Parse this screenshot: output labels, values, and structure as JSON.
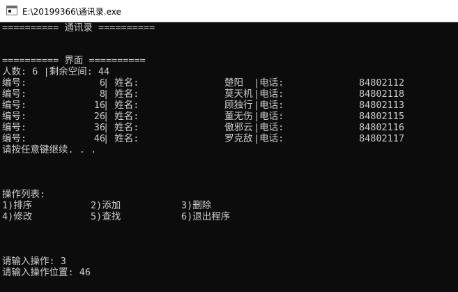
{
  "window": {
    "title": "E:\\20199366\\通讯录.exe"
  },
  "console": {
    "header": "========== 通讯录 ==========",
    "section": "========== 界面 ==========",
    "summary": "人数: 6 |剩余空间: 44",
    "records": [
      {
        "id_label": "编号:",
        "id": "6",
        "name_label": "| 姓名:",
        "name": "楚阳",
        "phone_label": "|电话:",
        "phone": "84802112"
      },
      {
        "id_label": "编号:",
        "id": "8",
        "name_label": "| 姓名:",
        "name": "莫天机",
        "phone_label": "|电话:",
        "phone": "84802118"
      },
      {
        "id_label": "编号:",
        "id": "16",
        "name_label": "| 姓名:",
        "name": "顾独行",
        "phone_label": "|电话:",
        "phone": "84802113"
      },
      {
        "id_label": "编号:",
        "id": "26",
        "name_label": "| 姓名:",
        "name": "董无伤",
        "phone_label": "|电话:",
        "phone": "84802115"
      },
      {
        "id_label": "编号:",
        "id": "36",
        "name_label": "| 姓名:",
        "name": "傲邪云",
        "phone_label": "|电话:",
        "phone": "84802116"
      },
      {
        "id_label": "编号:",
        "id": "46",
        "name_label": "| 姓名:",
        "name": "罗克敌",
        "phone_label": "|电话:",
        "phone": "84802117"
      }
    ],
    "pause_prompt": "请按任意键继续. . .",
    "menu_title": "操作列表:",
    "menu_row1": [
      "1)排序",
      "2)添加",
      "3)删除"
    ],
    "menu_row2": [
      "4)修改",
      "5)查找",
      "6)退出程序"
    ],
    "input_prompt": "请输入操作: 3",
    "position_prompt": "请输入操作位置: 46"
  },
  "colors": {
    "console_background": "#0c0c0c",
    "console_text": "#cccccc",
    "titlebar_background": "#ffffff"
  }
}
